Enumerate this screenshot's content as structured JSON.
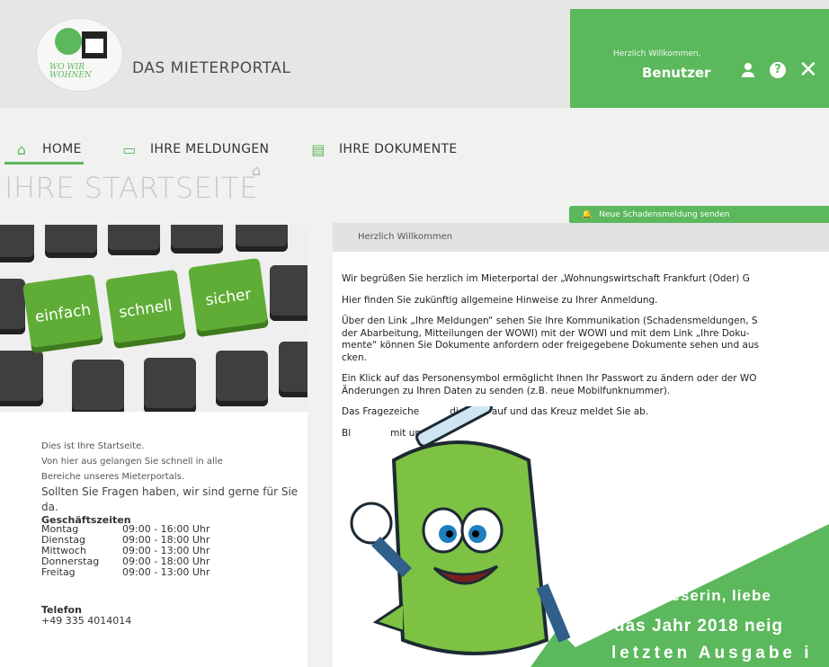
{
  "header": {
    "portal_title": "DAS MIETERPORTAL",
    "logo_text": "WO WIR WOHNEN",
    "welcome": "Herzlich Willkommen,",
    "user": "Benutzer"
  },
  "nav": {
    "home": "HOME",
    "meldungen": "IHRE MELDUNGEN",
    "dokumente": "IHRE DOKUMENTE"
  },
  "page_title": "IHRE STARTSEITE",
  "action_button": "Neue Schadensmeldung senden",
  "keyboard": {
    "key1": "einfach",
    "key2": "schnell",
    "key3": "sicher"
  },
  "left": {
    "line1": "Dies ist Ihre Startseite.",
    "line2": "Von hier aus gelangen Sie schnell in alle",
    "line3": "Bereiche unseres Mieterportals.",
    "line4": "Sollten Sie Fragen haben, wir sind gerne für Sie da.",
    "hours_title": "Geschäftszeiten",
    "hours": [
      {
        "day": "Montag",
        "time": "09:00 - 16:00 Uhr"
      },
      {
        "day": "Dienstag",
        "time": "09:00 - 18:00 Uhr"
      },
      {
        "day": "Mittwoch",
        "time": "09:00 - 13:00 Uhr"
      },
      {
        "day": "Donnerstag",
        "time": "09:00 - 18:00 Uhr"
      },
      {
        "day": "Freitag",
        "time": "09:00 - 13:00 Uhr"
      }
    ],
    "phone_title": "Telefon",
    "phone": "+49 335 4014014"
  },
  "right": {
    "heading": "Herzlich Willkommen",
    "p1": "Wir begrüßen Sie herzlich im Mieterportal der „Wohnungswirtschaft Frankfurt (Oder) G",
    "p2": "Hier finden Sie zukünftig allgemeine Hinweise zu Ihrer Anmeldung.",
    "p3a": "Über den Link „Ihre Meldungen“ sehen Sie Ihre Kommunikation (Schadensmeldungen, S",
    "p3b": "der Abarbeitung, Mitteilungen der WOWI) mit der WOWI und mit dem Link „Ihre Doku-",
    "p3c": "mente“ können Sie Dokumente anfordern oder freigegebene Dokumente sehen und aus",
    "p3d": "cken.",
    "p4a": "Ein Klick auf das Personensymbol ermöglicht Ihnen Ihr Passwort zu ändern oder  der WO",
    "p4b": "Änderungen zu Ihren Daten zu senden (z.B. neue Mobilfunknummer).",
    "p5a": "Das Fragezeiche",
    "p5b": "die Hilfe auf und das Kreuz meldet Sie ab.",
    "p6a": "Bl",
    "p6b": "mit uns i"
  },
  "promo": {
    "line1": "Liebe Leserin, liebe",
    "line2": "das Jahr 2018 neig",
    "line3": "letzten Ausgabe i"
  },
  "colors": {
    "brand_green": "#5cb85c",
    "key_green": "#5fad36"
  }
}
